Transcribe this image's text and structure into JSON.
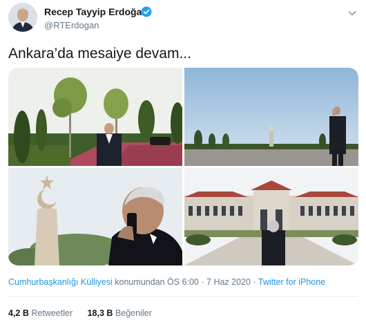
{
  "author": {
    "display_name": "Recep Tayyip Erdoğan",
    "handle": "@RTErdogan",
    "verified_icon": "verified-badge-icon",
    "menu_icon": "chevron-down-icon"
  },
  "tweet": {
    "text": "Ankara’da mesaiye devam...",
    "photos": [
      "photo-1",
      "photo-2",
      "photo-3",
      "photo-4"
    ]
  },
  "meta": {
    "location": "Cumhurbaşkanlığı Külliyesi",
    "location_suffix": "konumundan",
    "time": "ÖS 6:00",
    "separator": "·",
    "date": "7 Haz 2020",
    "source": "Twitter for iPhone"
  },
  "stats": {
    "retweets_count": "4,2 B",
    "retweets_label": "Retweetler",
    "likes_count": "18,3 B",
    "likes_label": "Beğeniler"
  },
  "colors": {
    "link": "#1b95e0",
    "muted": "#657786",
    "text": "#14171a",
    "verified": "#1da1f2"
  }
}
